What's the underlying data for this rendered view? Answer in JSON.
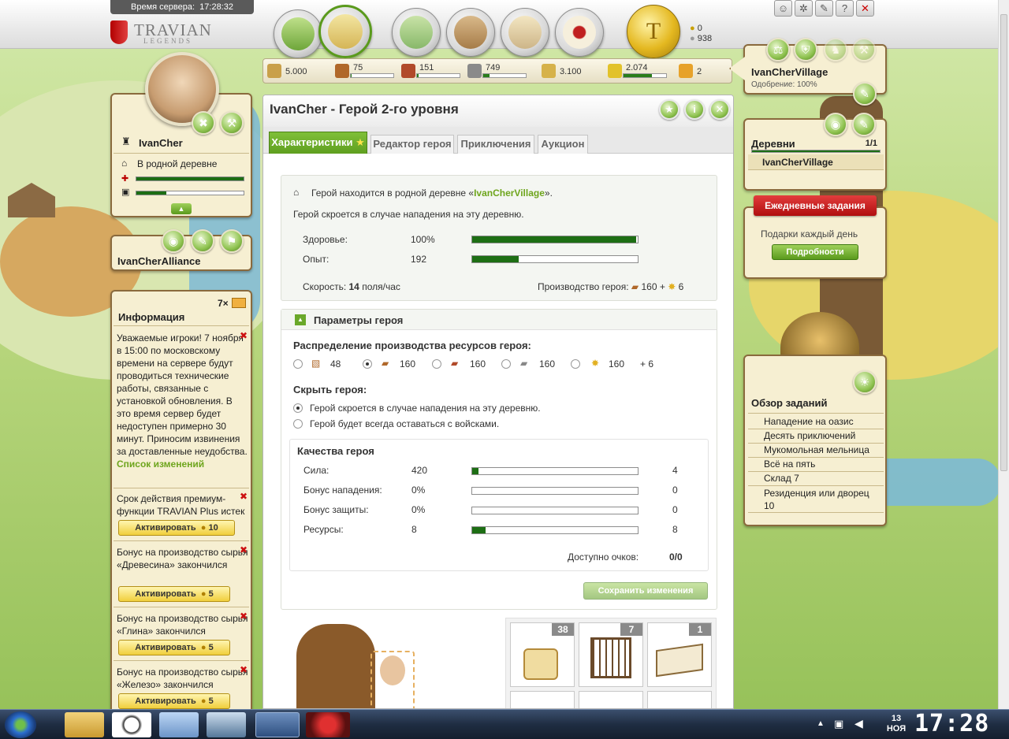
{
  "server_time_label": "Время сервера:",
  "server_time": "17:28:32",
  "logo": {
    "title": "TRAVIAN",
    "subtitle": "LEGENDS"
  },
  "gold": {
    "symbol": "T",
    "gold": "0",
    "silver": "938"
  },
  "top_icons": [
    "person-icon",
    "gear-icon",
    "edit-icon",
    "help-icon",
    "close-icon"
  ],
  "resources": {
    "warehouse": "5.000",
    "wood": "75",
    "clay": "151",
    "iron": "749",
    "granary": "3.100",
    "crop": "2.074",
    "crop_consumption": "2",
    "wood_fill": 0.015,
    "clay_fill": 0.03,
    "iron_fill": 0.15,
    "crop_fill": 0.67
  },
  "hero": {
    "name": "IvanCher",
    "status": "В родной деревне",
    "alliance": "IvanCherAlliance",
    "health_fill": 1.0,
    "exp_fill": 0.28
  },
  "info": {
    "count": "7×",
    "title": "Информация",
    "messages": [
      {
        "text": "Уважаемые игроки! 7 ноября в 15:00 по московскому времени на сервере будут проводиться технические работы, связанные с установкой обновления. В это время сервер будет недоступен примерно 30 минут. Приносим извинения за доставленные неудобства.",
        "link": "Список изменений"
      },
      {
        "text": "Срок действия премиум-функции TRAVIAN Plus истек",
        "button": "Активировать",
        "cost": "10"
      },
      {
        "text": "Бонус на производство сырья «Древесина» закончился",
        "button": "Активировать",
        "cost": "5"
      },
      {
        "text": "Бонус на производство сырья «Глина» закончился",
        "button": "Активировать",
        "cost": "5"
      },
      {
        "text": "Бонус на производство сырья «Железо» закончился",
        "button": "Активировать",
        "cost": "5"
      }
    ]
  },
  "main": {
    "title": "IvanCher - Герой 2-го уровня",
    "tabs": [
      "Характеристики",
      "Редактор героя",
      "Приключения",
      "Аукцион"
    ],
    "location_prefix": "Герой находится в родной деревне «",
    "location_village": "IvanCherVillage",
    "location_suffix": "».",
    "hide_info": "Герой скроется в случае нападения на эту деревню.",
    "health_label": "Здоровье:",
    "health_value": "100%",
    "health_fill": 0.99,
    "exp_label": "Опыт:",
    "exp_value": "192",
    "exp_fill": 0.28,
    "speed_label": "Скорость:",
    "speed_value": "14",
    "speed_unit": "поля/час",
    "production_label": "Производство героя:",
    "production_res": "160",
    "production_crop": "6",
    "params_title": "Параметры героя",
    "distribution_title": "Распределение производства ресурсов героя:",
    "distribution": [
      {
        "value": "48",
        "selected": false
      },
      {
        "value": "160",
        "selected": true
      },
      {
        "value": "160",
        "selected": false
      },
      {
        "value": "160",
        "selected": false
      },
      {
        "value": "160",
        "selected": false
      }
    ],
    "distribution_crop": "+ 6",
    "hide_title": "Скрыть героя:",
    "hide_options": [
      "Герой скроется в случае нападения на эту деревню.",
      "Герой будет всегда оставаться с войсками."
    ],
    "qualities_title": "Качества героя",
    "qualities": [
      {
        "label": "Сила:",
        "value": "420",
        "points": "4",
        "fill": 0.04
      },
      {
        "label": "Бонус нападения:",
        "value": "0%",
        "points": "0",
        "fill": 0
      },
      {
        "label": "Бонус защиты:",
        "value": "0%",
        "points": "0",
        "fill": 0
      },
      {
        "label": "Ресурсы:",
        "value": "8",
        "points": "8",
        "fill": 0.08
      }
    ],
    "points_label": "Доступно очков:",
    "points_value": "0/0",
    "save_button": "Сохранить изменения",
    "inventory_counts": [
      "38",
      "7",
      "1"
    ]
  },
  "village": {
    "name": "IvanCherVillage",
    "approval": "Одобрение: 100%",
    "villages_title": "Деревни",
    "villages_count": "1/1",
    "villages": [
      "IvanCherVillage"
    ]
  },
  "daily": {
    "title": "Ежедневные задания",
    "subtitle": "Подарки каждый день",
    "button": "Подробности"
  },
  "quests": {
    "title": "Обзор заданий",
    "items": [
      "Нападение на оазис",
      "Десять приключений",
      "Мукомольная мельница",
      "Всё на пять",
      "Склад 7",
      "Резиденция или дворец 10"
    ]
  },
  "taskbar": {
    "day": "13",
    "month": "НОЯ",
    "time": "17:28"
  }
}
